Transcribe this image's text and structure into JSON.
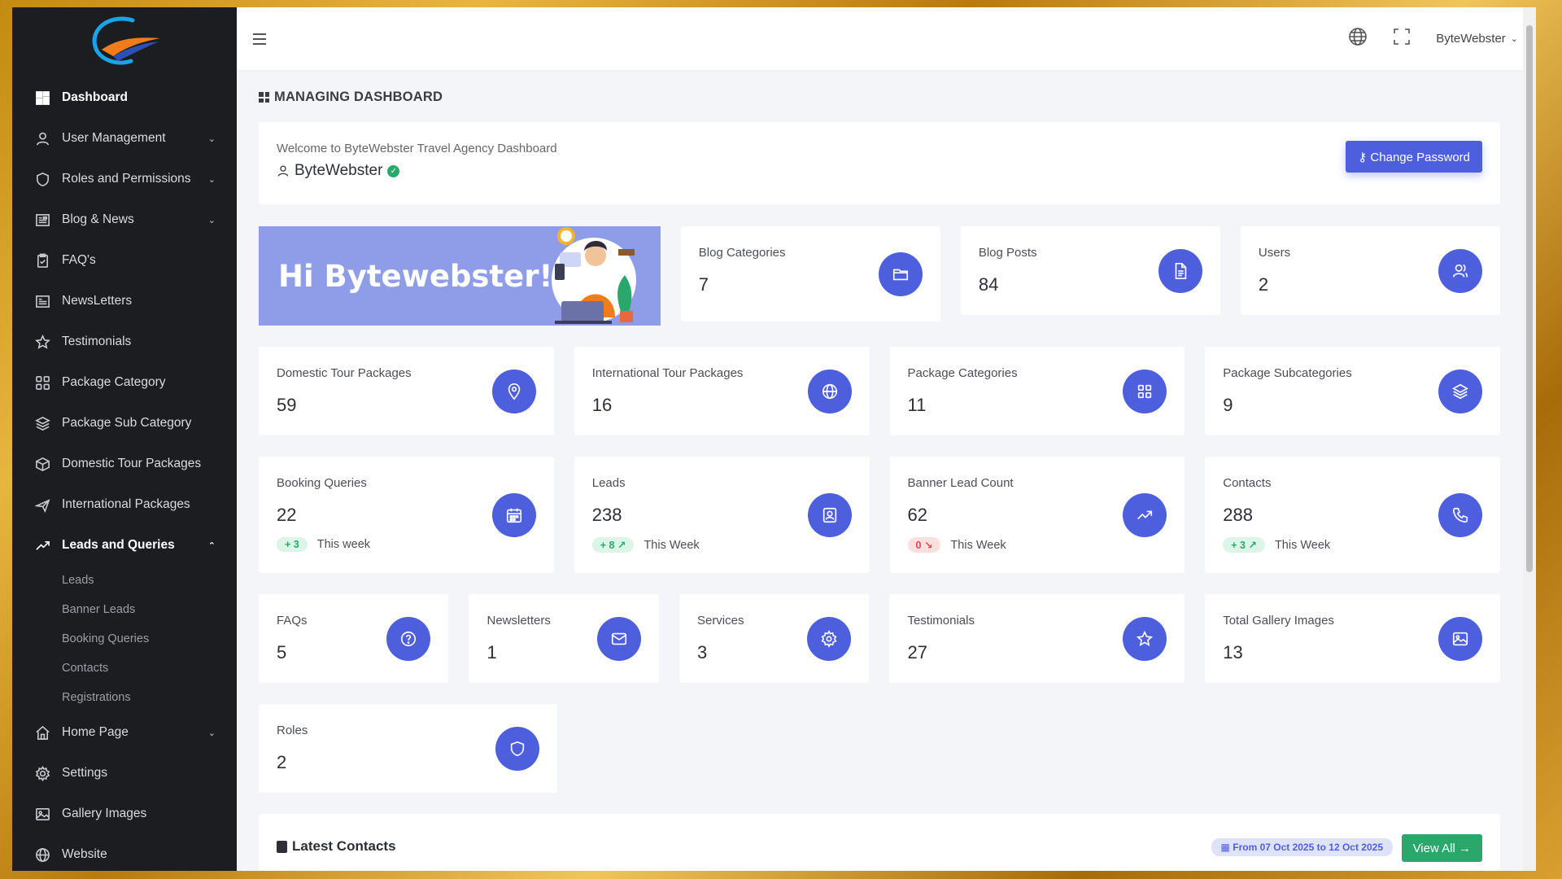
{
  "brand": {
    "accent": "#4e5fdd",
    "sidebar_bg": "#1c1d21",
    "success": "#2aa86b",
    "danger": "#e04848"
  },
  "sidebar": {
    "items": [
      {
        "label": "Dashboard",
        "icon": "grid-icon",
        "active": true
      },
      {
        "label": "User Management",
        "icon": "user-icon",
        "chevron": true
      },
      {
        "label": "Roles and Permissions",
        "icon": "shield-icon",
        "chevron": true
      },
      {
        "label": "Blog & News",
        "icon": "newspaper-icon",
        "chevron": true
      },
      {
        "label": "FAQ's",
        "icon": "clipboard-icon"
      },
      {
        "label": "NewsLetters",
        "icon": "newspaper-icon"
      },
      {
        "label": "Testimonials",
        "icon": "star-icon"
      },
      {
        "label": "Package Category",
        "icon": "apps-icon"
      },
      {
        "label": "Package Sub Category",
        "icon": "layers-icon"
      },
      {
        "label": "Domestic Tour Packages",
        "icon": "box-icon"
      },
      {
        "label": "International Packages",
        "icon": "plane-icon"
      },
      {
        "label": "Leads and Queries",
        "icon": "trending-icon",
        "open": true
      },
      {
        "label": "Home Page",
        "icon": "home-icon",
        "chevron": true
      },
      {
        "label": "Settings",
        "icon": "gear-icon"
      },
      {
        "label": "Gallery Images",
        "icon": "image-icon"
      },
      {
        "label": "Website",
        "icon": "globe-icon"
      }
    ],
    "leads_sub": [
      "Leads",
      "Banner Leads",
      "Booking Queries",
      "Contacts",
      "Registrations"
    ]
  },
  "topbar": {
    "user": "ByteWebster"
  },
  "page": {
    "title": "MANAGING DASHBOARD"
  },
  "welcome": {
    "text": "Welcome to ByteWebster Travel Agency Dashboard",
    "name": "ByteWebster",
    "button": "Change Password"
  },
  "banner": {
    "greeting": "Hi Bytewebster!"
  },
  "stats_row1": [
    {
      "label": "Blog Categories",
      "value": "7",
      "icon": "folder-icon"
    },
    {
      "label": "Blog Posts",
      "value": "84",
      "icon": "document-icon"
    },
    {
      "label": "Users",
      "value": "2",
      "icon": "users-icon"
    }
  ],
  "stats_row2": [
    {
      "label": "Domestic Tour Packages",
      "value": "59",
      "icon": "map-pin-icon"
    },
    {
      "label": "International Tour Packages",
      "value": "16",
      "icon": "globe-icon"
    },
    {
      "label": "Package Categories",
      "value": "11",
      "icon": "apps-icon"
    },
    {
      "label": "Package Subcategories",
      "value": "9",
      "icon": "layers-icon"
    }
  ],
  "stats_row3": [
    {
      "label": "Booking Queries",
      "value": "22",
      "icon": "calendar-icon",
      "delta": "+ 3",
      "dir": "up",
      "period": "This week"
    },
    {
      "label": "Leads",
      "value": "238",
      "icon": "contact-card-icon",
      "delta": "+ 8",
      "dir": "up",
      "period": "This Week"
    },
    {
      "label": "Banner Lead Count",
      "value": "62",
      "icon": "trending-icon",
      "delta": "0",
      "dir": "down",
      "period": "This Week"
    },
    {
      "label": "Contacts",
      "value": "288",
      "icon": "phone-icon",
      "delta": "+ 3",
      "dir": "up",
      "period": "This Week"
    }
  ],
  "stats_row4": [
    {
      "label": "FAQs",
      "value": "5",
      "icon": "question-icon"
    },
    {
      "label": "Newsletters",
      "value": "1",
      "icon": "mail-icon"
    },
    {
      "label": "Services",
      "value": "3",
      "icon": "gear-icon"
    },
    {
      "label": "Testimonials",
      "value": "27",
      "icon": "star-icon"
    },
    {
      "label": "Total Gallery Images",
      "value": "13",
      "icon": "image-icon"
    }
  ],
  "stats_row5": [
    {
      "label": "Roles",
      "value": "2",
      "icon": "shield-icon"
    }
  ],
  "latest": {
    "title": "Latest Contacts",
    "date_range": "From 07 Oct 2025 to 12 Oct 2025",
    "button": "View All →"
  }
}
